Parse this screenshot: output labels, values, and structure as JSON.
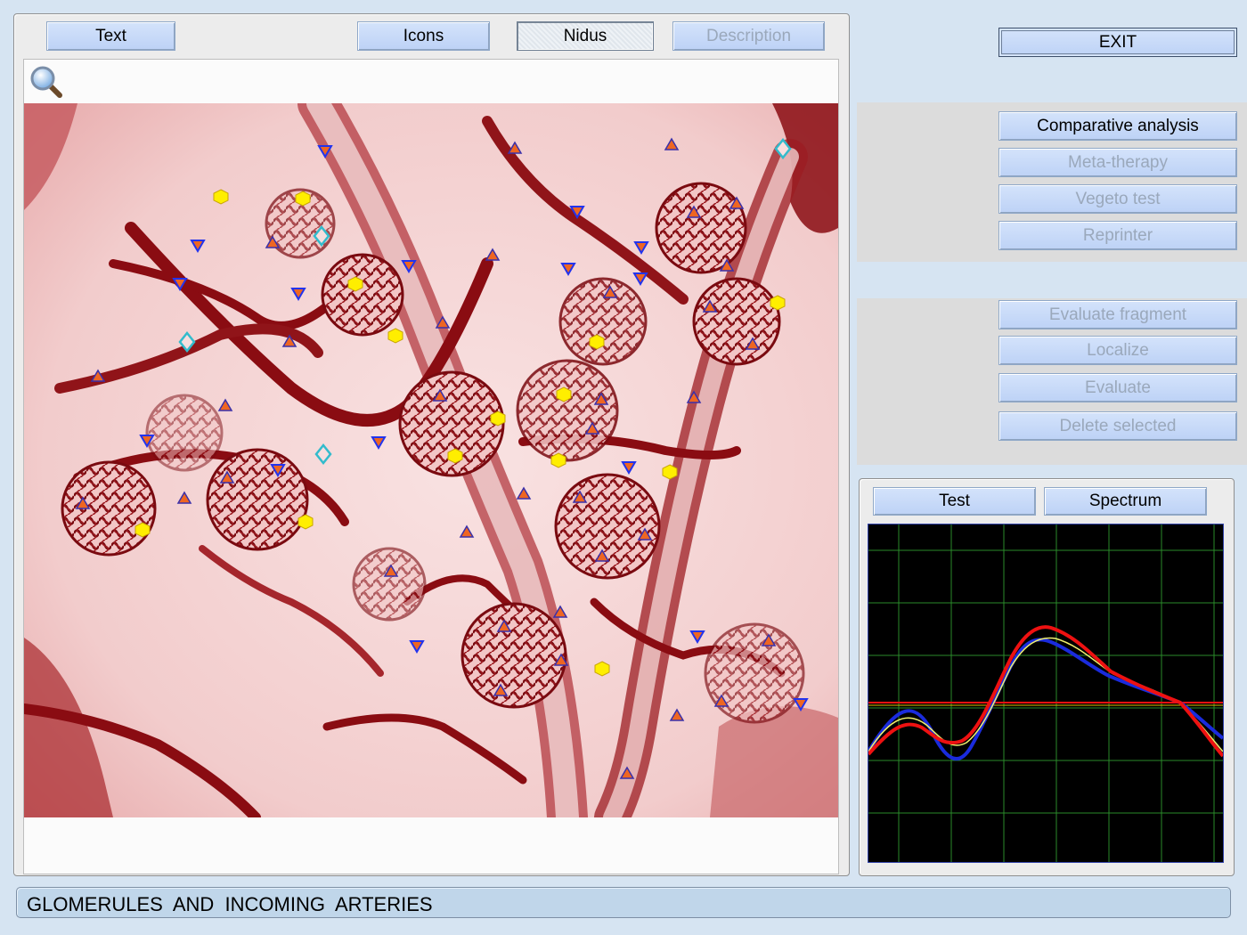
{
  "left_tabs": {
    "text": "Text",
    "icons": "Icons",
    "nidus": "Nidus",
    "description": "Description"
  },
  "exit_label": "EXIT",
  "analysis_buttons": {
    "comparative": "Comparative analysis",
    "meta_therapy": "Meta-therapy",
    "vegeto": "Vegeto test",
    "reprinter": "Reprinter"
  },
  "fragment_buttons": {
    "evaluate_fragment": "Evaluate fragment",
    "localize": "Localize",
    "evaluate": "Evaluate",
    "delete_selected": "Delete selected"
  },
  "spectrum_tabs": {
    "test": "Test",
    "spectrum": "Spectrum"
  },
  "status_caption": "GLOMERULES  AND  INCOMING  ARTERIES",
  "colors": {
    "tissue_dark": "#8a0c12",
    "tissue_light": "#f6d8d8",
    "marker_yellow": "#ffee00",
    "marker_orange": "#ee6622",
    "marker_blue": "#2233ee",
    "marker_cyan": "#33bbcc",
    "graph_grid": "#2a8a2a",
    "series_red": "#ee1111",
    "series_blue": "#1a2bdd",
    "series_yellow": "#f0f070"
  },
  "icons": {
    "zoom": "magnifier-icon"
  }
}
